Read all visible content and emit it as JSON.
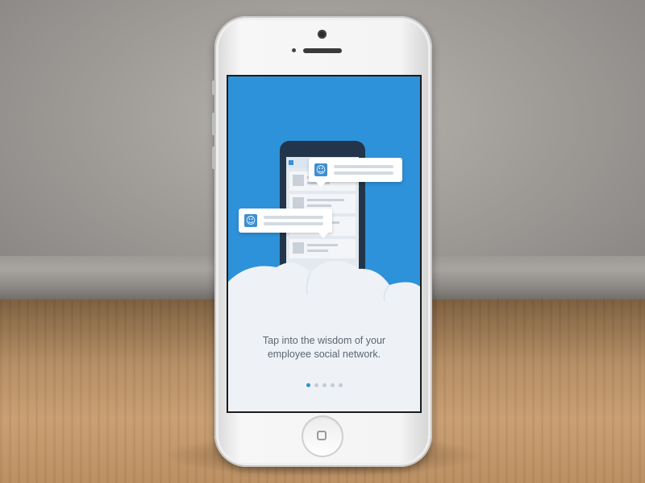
{
  "scene": {
    "device": "iphone-white",
    "onboarding": {
      "tagline_line1": "Tap into the wisdom of your",
      "tagline_line2": "employee social network.",
      "pagination": {
        "total": 5,
        "active_index": 0
      },
      "colors": {
        "background_blue": "#2d92d9",
        "cloud": "#eef2f6",
        "text": "#5d6670",
        "dot_active": "#2d92d9",
        "dot_inactive": "#c5ccd3"
      },
      "icons": {
        "chat_avatar_1": "smiley-icon",
        "chat_avatar_2": "smiley-icon"
      }
    }
  }
}
